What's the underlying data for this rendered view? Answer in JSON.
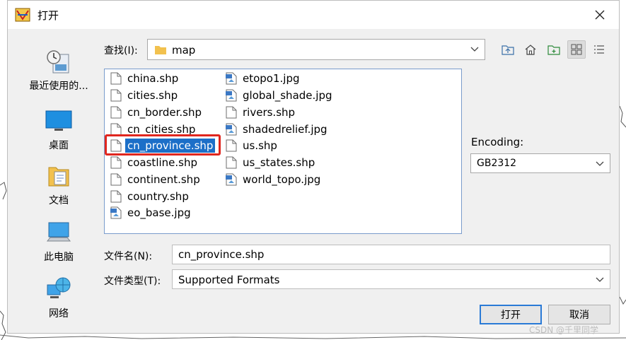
{
  "window": {
    "title": "打开"
  },
  "places": [
    {
      "label": "最近使用的...",
      "icon": "recent-places-icon"
    },
    {
      "label": "桌面",
      "icon": "desktop-icon"
    },
    {
      "label": "文档",
      "icon": "documents-icon"
    },
    {
      "label": "此电脑",
      "icon": "this-pc-icon"
    },
    {
      "label": "网络",
      "icon": "network-icon"
    }
  ],
  "lookin": {
    "label": "查找(I):",
    "value": "map"
  },
  "toolbar": [
    "up-folder-icon",
    "home-icon",
    "new-folder-icon",
    "list-view-icon",
    "detail-view-icon"
  ],
  "files": {
    "col1": [
      {
        "name": "china.shp",
        "type": "shp"
      },
      {
        "name": "cities.shp",
        "type": "shp"
      },
      {
        "name": "cn_border.shp",
        "type": "shp"
      },
      {
        "name": "cn_cities.shp",
        "type": "shp"
      },
      {
        "name": "cn_province.shp",
        "type": "shp",
        "selected": true
      },
      {
        "name": "coastline.shp",
        "type": "shp"
      },
      {
        "name": "continent.shp",
        "type": "shp"
      },
      {
        "name": "country.shp",
        "type": "shp"
      },
      {
        "name": "eo_base.jpg",
        "type": "jpg"
      }
    ],
    "col2": [
      {
        "name": "etopo1.jpg",
        "type": "jpg"
      },
      {
        "name": "global_shade.jpg",
        "type": "jpg"
      },
      {
        "name": "rivers.shp",
        "type": "shp"
      },
      {
        "name": "shadedrelief.jpg",
        "type": "jpg"
      },
      {
        "name": "us.shp",
        "type": "shp"
      },
      {
        "name": "us_states.shp",
        "type": "shp"
      },
      {
        "name": "world_topo.jpg",
        "type": "jpg"
      }
    ]
  },
  "encoding": {
    "label": "Encoding:",
    "value": "GB2312"
  },
  "filename": {
    "label": "文件名(N):",
    "value": "cn_province.shp"
  },
  "filetype": {
    "label": "文件类型(T):",
    "value": "Supported Formats"
  },
  "buttons": {
    "open": "打开",
    "cancel": "取消"
  },
  "watermark": "CSDN @千里同学",
  "colors": {
    "selection": "#1c6fc8",
    "highlight_outline": "#e0261e",
    "default_button_border": "#2a7ad6"
  }
}
